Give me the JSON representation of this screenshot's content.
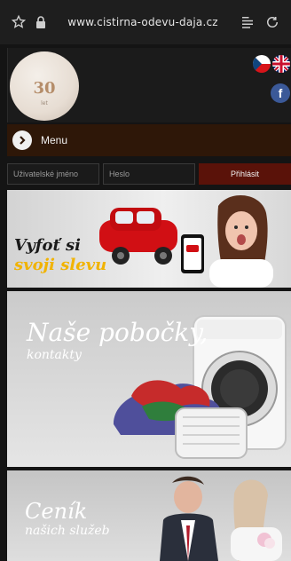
{
  "browser": {
    "url": "www.cistirna-odevu-daja.cz",
    "icons": [
      "star-icon",
      "lock-icon",
      "reader-mode-icon",
      "reload-icon"
    ]
  },
  "header": {
    "logo_text": "30",
    "logo_sub": "let",
    "languages": [
      "cz",
      "en"
    ],
    "social": "facebook"
  },
  "menu": {
    "label": "Menu"
  },
  "login": {
    "username_placeholder": "Uživatelské jméno",
    "password_placeholder": "Heslo",
    "submit_label": "Přihlásit"
  },
  "banners": [
    {
      "line1": "Vyfoť si",
      "line2": "svoji slevu"
    },
    {
      "title": "Naše pobočky,",
      "subtitle": "kontakty"
    },
    {
      "title": "Ceník",
      "subtitle": "našich služeb"
    }
  ],
  "colors": {
    "menu_bg": "#2e1708",
    "login_btn": "#5a1209",
    "accent_yellow": "#f1b300"
  }
}
